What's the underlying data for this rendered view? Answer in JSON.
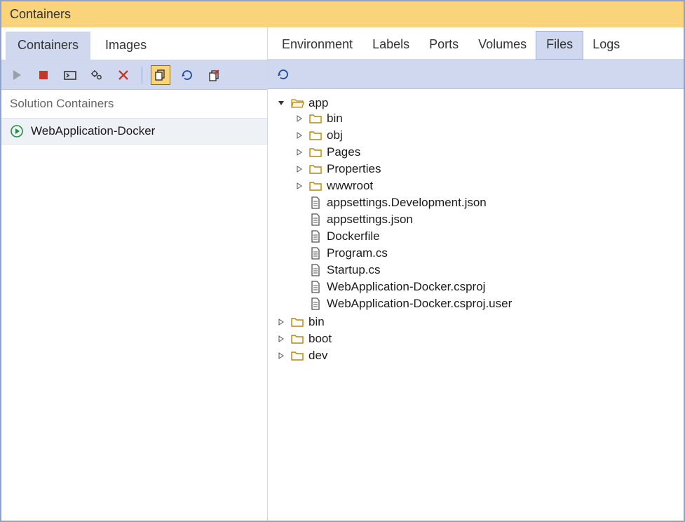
{
  "title": "Containers",
  "leftTabs": [
    {
      "id": "containers",
      "label": "Containers",
      "active": true
    },
    {
      "id": "images",
      "label": "Images",
      "active": false
    }
  ],
  "detailTabs": [
    {
      "id": "environment",
      "label": "Environment",
      "active": false
    },
    {
      "id": "labels",
      "label": "Labels",
      "active": false
    },
    {
      "id": "ports",
      "label": "Ports",
      "active": false
    },
    {
      "id": "volumes",
      "label": "Volumes",
      "active": false
    },
    {
      "id": "files",
      "label": "Files",
      "active": true
    },
    {
      "id": "logs",
      "label": "Logs",
      "active": false
    }
  ],
  "leftToolbar": [
    {
      "name": "start-button",
      "icon": "play",
      "color": "#9aa0a6"
    },
    {
      "name": "stop-button",
      "icon": "stop",
      "color": "#c0392b"
    },
    {
      "name": "attach-terminal-button",
      "icon": "terminal",
      "color": "#333"
    },
    {
      "name": "settings-button",
      "icon": "gears",
      "color": "#333"
    },
    {
      "name": "delete-button",
      "icon": "x",
      "color": "#c0392b"
    },
    {
      "sep": true
    },
    {
      "name": "copy-button",
      "icon": "copy",
      "color": "#333",
      "active": true
    },
    {
      "name": "refresh-button",
      "icon": "refresh",
      "color": "#1b4aa0"
    },
    {
      "name": "prune-button",
      "icon": "prune",
      "color": "#333"
    }
  ],
  "rightToolbar": [
    {
      "name": "refresh-files-button",
      "icon": "refresh",
      "color": "#1b4aa0"
    }
  ],
  "sectionHeader": "Solution Containers",
  "containers": [
    {
      "name": "WebApplication-Docker",
      "state": "running"
    }
  ],
  "fileTree": [
    {
      "name": "app",
      "type": "folder",
      "open": true,
      "children": [
        {
          "name": "bin",
          "type": "folder"
        },
        {
          "name": "obj",
          "type": "folder"
        },
        {
          "name": "Pages",
          "type": "folder"
        },
        {
          "name": "Properties",
          "type": "folder"
        },
        {
          "name": "wwwroot",
          "type": "folder"
        },
        {
          "name": "appsettings.Development.json",
          "type": "file"
        },
        {
          "name": "appsettings.json",
          "type": "file"
        },
        {
          "name": "Dockerfile",
          "type": "file"
        },
        {
          "name": "Program.cs",
          "type": "file"
        },
        {
          "name": "Startup.cs",
          "type": "file"
        },
        {
          "name": "WebApplication-Docker.csproj",
          "type": "file"
        },
        {
          "name": "WebApplication-Docker.csproj.user",
          "type": "file"
        }
      ]
    },
    {
      "name": "bin",
      "type": "folder"
    },
    {
      "name": "boot",
      "type": "folder"
    },
    {
      "name": "dev",
      "type": "folder"
    }
  ],
  "icons": {
    "folderStroke": "#b8860b",
    "folderFill": "#ffffff",
    "folderOpenFill": "#fff6dc",
    "fileStroke": "#555"
  }
}
